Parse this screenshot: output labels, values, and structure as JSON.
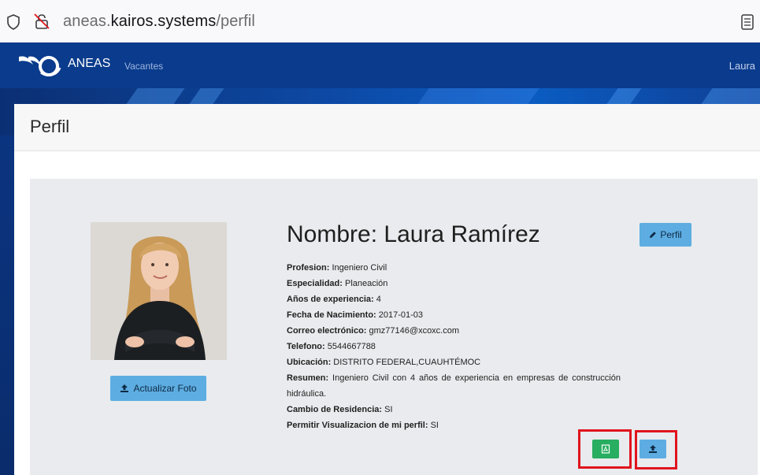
{
  "browser": {
    "url_prefix": "aneas.",
    "url_host": "kairos.systems",
    "url_path": "/perfil"
  },
  "navbar": {
    "brand": "ANEAS",
    "links": [
      "Vacantes"
    ],
    "user": "Laura"
  },
  "page": {
    "title": "Perfil"
  },
  "profile": {
    "name_label": "Nombre:",
    "name": "Laura Ramírez",
    "edit_button": "Perfil",
    "update_photo_button": "Actualizar Foto",
    "fields": [
      {
        "label": "Profesion:",
        "value": "Ingeniero Civil"
      },
      {
        "label": "Especialidad:",
        "value": "Planeación"
      },
      {
        "label": "Años de experiencia:",
        "value": "4"
      },
      {
        "label": "Fecha de Nacimiento:",
        "value": "2017-01-03"
      },
      {
        "label": "Correo electrónico:",
        "value": "gmz77146@xcoxc.com"
      },
      {
        "label": "Telefono:",
        "value": "5544667788"
      },
      {
        "label": "Ubicación:",
        "value": "DISTRITO FEDERAL,CUAUHTÉMOC"
      },
      {
        "label": "Resumen:",
        "value": "Ingeniero Civil con 4 años de experiencia en empresas de construcción hidráulica."
      },
      {
        "label": "Cambio de Residencia:",
        "value": "SI"
      },
      {
        "label": "Permitir Visualizacion de mi perfil:",
        "value": "SI"
      }
    ]
  },
  "icons": {
    "pdf_button": "file-pdf-icon",
    "upload_button": "upload-icon",
    "edit": "pencil-icon"
  },
  "colors": {
    "navbar": "#0a3b8c",
    "button_blue": "#5dade2",
    "button_green": "#27ae60",
    "highlight": "#e0141e"
  }
}
